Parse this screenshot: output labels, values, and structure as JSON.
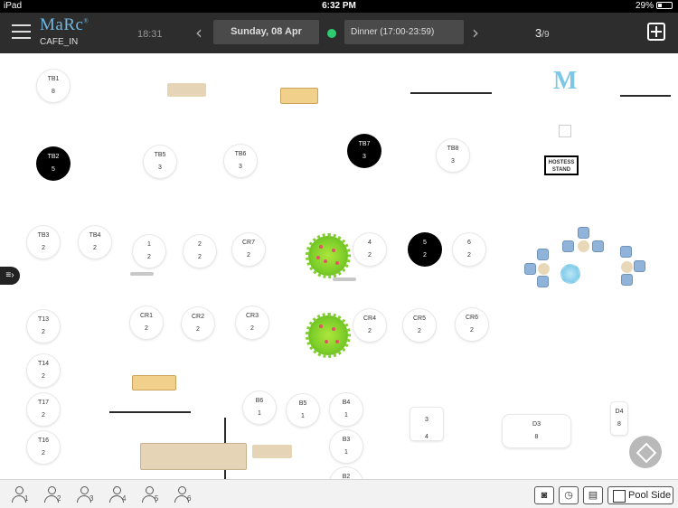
{
  "status_bar": {
    "device": "iPad",
    "time": "6:32 PM",
    "battery": "29%"
  },
  "header": {
    "app_logo": "MaRc",
    "logo_mark": "®",
    "venue": "CAFE_IN",
    "current_time": "18:31",
    "date": "Sunday, 08 Apr",
    "shift": "Dinner (17:00-23:59)",
    "page_current": "3",
    "page_total": "/9",
    "nav_prev_icon": "chevron-left-icon",
    "nav_next_icon": "chevron-right-icon",
    "menu_icon": "hamburger-menu-icon",
    "add_icon": "add-reservation-icon",
    "status_color": "#2ecc71"
  },
  "floor": {
    "tables": [
      {
        "id": "TB1",
        "name": "TB1",
        "covers": "8",
        "state": "free"
      },
      {
        "id": "TB2",
        "name": "TB2",
        "covers": "5",
        "state": "occupied"
      },
      {
        "id": "TB5",
        "name": "TB5",
        "covers": "3",
        "state": "free"
      },
      {
        "id": "TB6",
        "name": "TB6",
        "covers": "3",
        "state": "free"
      },
      {
        "id": "TB7",
        "name": "TB7",
        "covers": "3",
        "state": "occupied"
      },
      {
        "id": "TB8",
        "name": "TB8",
        "covers": "3",
        "state": "free"
      },
      {
        "id": "TB3",
        "name": "TB3",
        "covers": "2",
        "state": "free"
      },
      {
        "id": "TB4",
        "name": "TB4",
        "covers": "2",
        "state": "free"
      },
      {
        "id": "T1",
        "name": "1",
        "covers": "2",
        "state": "free"
      },
      {
        "id": "T2",
        "name": "2",
        "covers": "2",
        "state": "free"
      },
      {
        "id": "CR7",
        "name": "CR7",
        "covers": "2",
        "state": "free"
      },
      {
        "id": "T4",
        "name": "4",
        "covers": "2",
        "state": "free"
      },
      {
        "id": "T5",
        "name": "5",
        "covers": "2",
        "state": "occupied"
      },
      {
        "id": "T6",
        "name": "6",
        "covers": "2",
        "state": "free"
      },
      {
        "id": "T13",
        "name": "T13",
        "covers": "2",
        "state": "free"
      },
      {
        "id": "CR1",
        "name": "CR1",
        "covers": "2",
        "state": "free"
      },
      {
        "id": "CR2",
        "name": "CR2",
        "covers": "2",
        "state": "free"
      },
      {
        "id": "CR3",
        "name": "CR3",
        "covers": "2",
        "state": "free"
      },
      {
        "id": "CR4",
        "name": "CR4",
        "covers": "2",
        "state": "free"
      },
      {
        "id": "CR5",
        "name": "CR5",
        "covers": "2",
        "state": "free"
      },
      {
        "id": "CR6",
        "name": "CR6",
        "covers": "2",
        "state": "free"
      },
      {
        "id": "T14",
        "name": "T14",
        "covers": "2",
        "state": "free"
      },
      {
        "id": "T17",
        "name": "T17",
        "covers": "2",
        "state": "free"
      },
      {
        "id": "T16",
        "name": "T16",
        "covers": "2",
        "state": "free"
      },
      {
        "id": "B6",
        "name": "B6",
        "covers": "1",
        "state": "free"
      },
      {
        "id": "B5",
        "name": "B5",
        "covers": "1",
        "state": "free"
      },
      {
        "id": "B4",
        "name": "B4",
        "covers": "1",
        "state": "free"
      },
      {
        "id": "B3",
        "name": "B3",
        "covers": "1",
        "state": "free"
      },
      {
        "id": "B2",
        "name": "B2",
        "covers": "",
        "state": "free"
      },
      {
        "id": "T34",
        "name": "3",
        "covers": "4",
        "state": "free"
      },
      {
        "id": "D3",
        "name": "D3",
        "covers": "8",
        "state": "free"
      },
      {
        "id": "D4",
        "name": "D4",
        "covers": "8",
        "state": "free"
      }
    ],
    "hostess_stand": "HOSTESS STAND",
    "brand_mark": "M",
    "side_panel_icon": "list-toggle-icon",
    "joystick_icon": "pan-navigation-icon"
  },
  "bottom_bar": {
    "party_sizes": [
      "1",
      "2",
      "3",
      "4",
      "5",
      "6"
    ],
    "party_icon": "guest-icon",
    "tools": [
      {
        "icon": "camera-icon",
        "glyph": "◙"
      },
      {
        "icon": "clock-icon",
        "glyph": "◷"
      },
      {
        "icon": "printer-icon",
        "glyph": "▤"
      }
    ],
    "area_button": "Pool Side",
    "area_icon": "floor-plan-icon"
  },
  "colors": {
    "header_bg": "#2d2d2d",
    "occupied": "#000000",
    "free": "#ffffff",
    "brand_blue": "#6fb8e3",
    "plant_green": "#7fcf2a"
  }
}
